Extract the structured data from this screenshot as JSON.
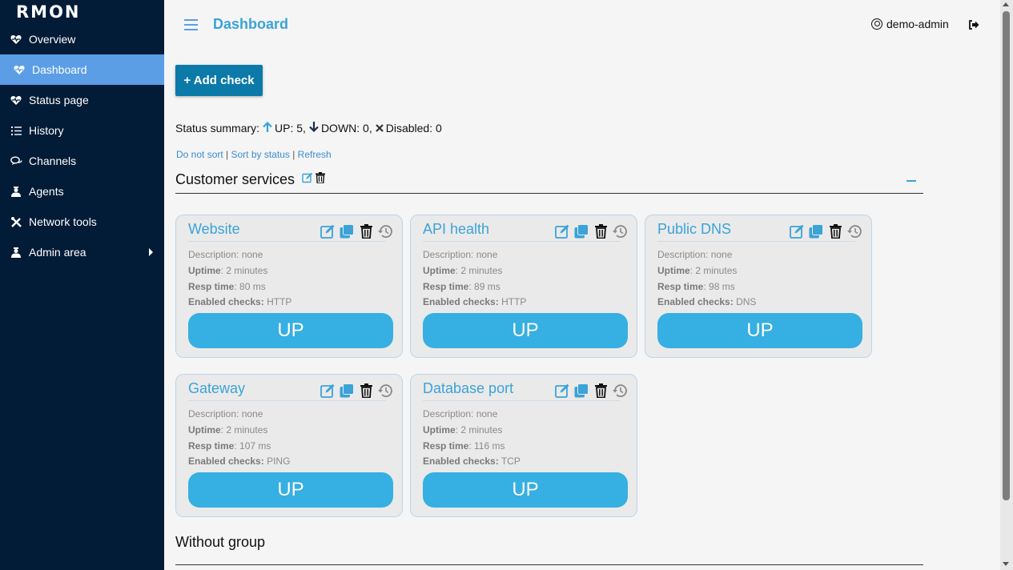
{
  "app": {
    "logo": "RMON"
  },
  "sidebar": {
    "items": [
      {
        "label": "Overview",
        "icon": "heartbeat-icon"
      },
      {
        "label": "Dashboard",
        "icon": "heartbeat-icon",
        "active": true
      },
      {
        "label": "Status page",
        "icon": "heartbeat-icon"
      },
      {
        "label": "History",
        "icon": "list-icon"
      },
      {
        "label": "Channels",
        "icon": "chat-icon"
      },
      {
        "label": "Agents",
        "icon": "agent-icon"
      },
      {
        "label": "Network tools",
        "icon": "tools-icon"
      },
      {
        "label": "Admin area",
        "icon": "admin-icon"
      }
    ]
  },
  "header": {
    "title": "Dashboard",
    "user": "demo-admin"
  },
  "toolbar": {
    "add_check_label": "+ Add check"
  },
  "summary": {
    "prefix": "Status summary:",
    "up": "UP: 5,",
    "down": "DOWN: 0,",
    "disabled": "Disabled: 0"
  },
  "sort": {
    "no_sort": "Do not sort",
    "sep1": " | ",
    "by_status": "Sort by status",
    "sep2": " | ",
    "refresh": "Refresh"
  },
  "groups": [
    {
      "name": "Customer services"
    },
    {
      "name": "Without group"
    }
  ],
  "labels": {
    "description": "Description:",
    "uptime": "Uptime",
    "resp_time": "Resp time",
    "enabled_checks": "Enabled checks:"
  },
  "checks": [
    {
      "name": "Website",
      "description": "none",
      "uptime": ": 2 minutes",
      "resp_time": ": 80 ms",
      "enabled": "HTTP",
      "status": "UP"
    },
    {
      "name": "API health",
      "description": "none",
      "uptime": ": 2 minutes",
      "resp_time": ": 89 ms",
      "enabled": "HTTP",
      "status": "UP"
    },
    {
      "name": "Public DNS",
      "description": "none",
      "uptime": ": 2 minutes",
      "resp_time": ": 98 ms",
      "enabled": "DNS",
      "status": "UP"
    },
    {
      "name": "Gateway",
      "description": "none",
      "uptime": ": 2 minutes",
      "resp_time": ": 107 ms",
      "enabled": "PING",
      "status": "UP"
    },
    {
      "name": "Database port",
      "description": "none",
      "uptime": ": 2 minutes",
      "resp_time": ": 116 ms",
      "enabled": "TCP",
      "status": "UP"
    }
  ],
  "colors": {
    "sidebar_bg": "#021b36",
    "active": "#5b9ee6",
    "accent": "#3aa3d8",
    "up": "#36afe2",
    "add_button": "#0b7aa8"
  }
}
